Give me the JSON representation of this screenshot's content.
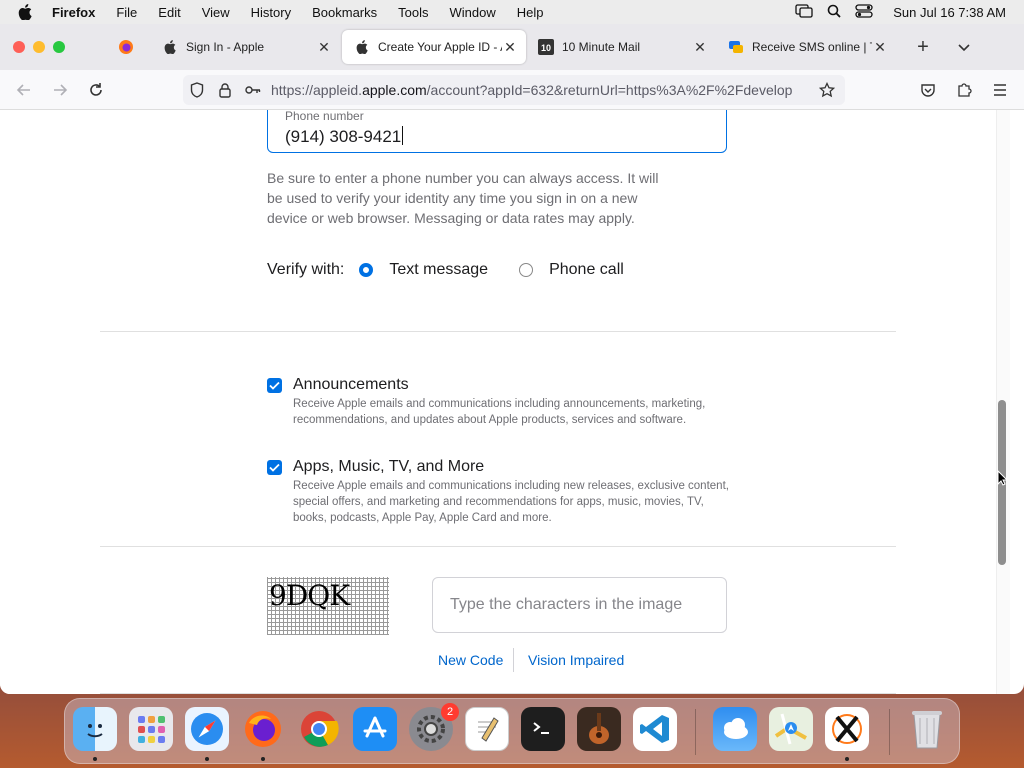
{
  "menubar": {
    "app": "Firefox",
    "items": [
      "File",
      "Edit",
      "View",
      "History",
      "Bookmarks",
      "Tools",
      "Window",
      "Help"
    ],
    "clock": "Sun Jul 16  7:38 AM"
  },
  "tabs": [
    {
      "label": "Sign In - Apple",
      "icon": "apple-icon"
    },
    {
      "label": "Create Your Apple ID - Ap",
      "icon": "apple-icon",
      "active": true
    },
    {
      "label": "10 Minute Mail",
      "icon": "ten-minute-mail-icon"
    },
    {
      "label": "Receive SMS online | Ter",
      "icon": "sms-icon"
    }
  ],
  "url": {
    "prefix": "https://appleid.",
    "domain": "apple.com",
    "rest": "/account?appId=632&returnUrl=https%3A%2F%2Fdevelop"
  },
  "phone": {
    "label": "Phone number",
    "value": "(914) 308-9421"
  },
  "help_text": "Be sure to enter a phone number you can always access. It will be used to verify your identity any time you sign in on a new device or web browser. Messaging or data rates may apply.",
  "verify": {
    "label": "Verify with:",
    "options": [
      "Text message",
      "Phone call"
    ],
    "selected": "Text message"
  },
  "subscriptions": [
    {
      "title": "Announcements",
      "description": "Receive Apple emails and communications including announcements, marketing, recommendations, and updates about Apple products, services and software.",
      "checked": true
    },
    {
      "title": "Apps, Music, TV, and More",
      "description": "Receive Apple emails and communications including new releases, exclusive content, special offers, and marketing and recommendations for apps, music, movies, TV, books, podcasts, Apple Pay, Apple Card and more.",
      "checked": true
    }
  ],
  "captcha": {
    "image_text": "9DQK",
    "placeholder": "Type the characters in the image",
    "new_code": "New Code",
    "vision_impaired": "Vision Impaired"
  },
  "dock": {
    "apps": [
      "Finder",
      "Launchpad",
      "Safari",
      "Firefox",
      "Chrome",
      "App Store",
      "System Settings",
      "TextEdit",
      "Terminal",
      "Instruments",
      "VS Code",
      "Weather",
      "Maps",
      "XQuartz",
      "Trash"
    ],
    "settings_badge": "2"
  },
  "colors": {
    "accent": "#0071e3",
    "link": "#0066cc"
  }
}
